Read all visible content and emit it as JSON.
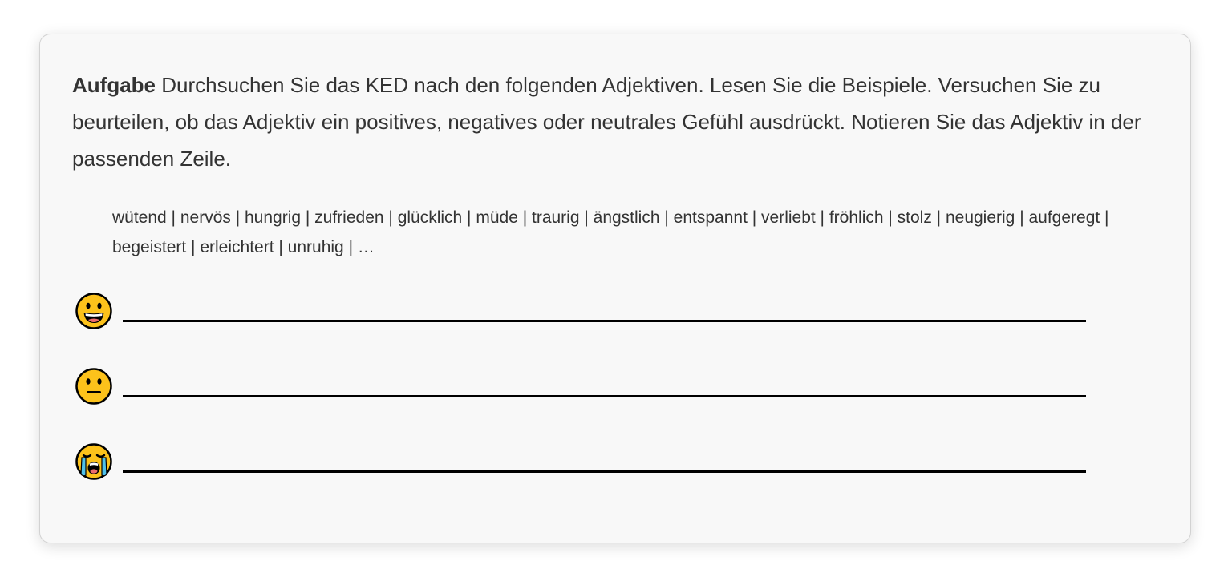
{
  "task": {
    "label": "Aufgabe",
    "text": " Durchsuchen Sie das KED nach den folgenden Adjektiven. Lesen Sie die Beispiele. Versuchen Sie zu beurteilen, ob das Adjektiv ein positives, negatives oder neutrales Gefühl ausdrückt. Notieren Sie das Adjektiv in der passenden Zeile."
  },
  "wordlist": "wütend | nervös | hungrig | zufrieden | glücklich | müde | traurig | ängstlich | entspannt | verliebt | fröhlich | stolz | neugierig | aufgeregt | begeistert | erleichtert | unruhig | …",
  "rows": [
    {
      "icon": "grinning-face-icon",
      "meaning": "positiv"
    },
    {
      "icon": "neutral-face-icon",
      "meaning": "neutral"
    },
    {
      "icon": "crying-face-icon",
      "meaning": "negativ"
    }
  ],
  "colors": {
    "card_background": "#f8f8f8",
    "emoji_yellow": "#fcc21b",
    "tear_blue": "#4fc1e9",
    "line": "#000000"
  }
}
